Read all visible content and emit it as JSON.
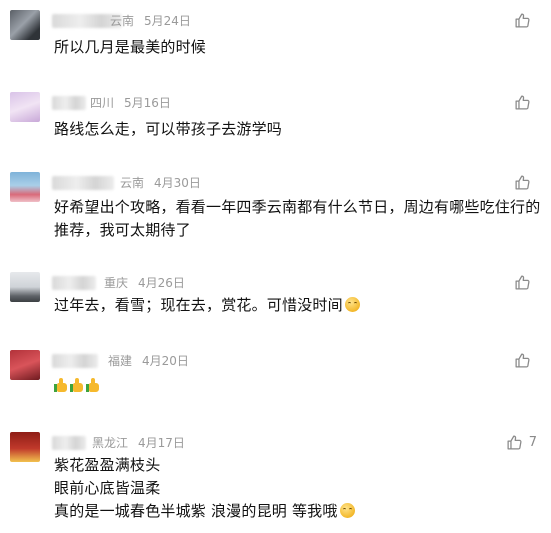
{
  "comments": [
    {
      "region": "云南",
      "date": "5月24日",
      "lines": [
        "所以几月是最美的时候"
      ],
      "like_count": ""
    },
    {
      "region": "四川",
      "date": "5月16日",
      "lines": [
        "路线怎么走，可以带孩子去游学吗"
      ],
      "like_count": ""
    },
    {
      "region": "云南",
      "date": "4月30日",
      "lines": [
        "好希望出个攻略，看看一年四季云南都有什么节日，周边有哪些吃住行的",
        "推荐，我可太期待了"
      ],
      "like_count": ""
    },
    {
      "region": "重庆",
      "date": "4月26日",
      "lines": [
        "过年去，看雪；现在去，赏花。可惜没时间"
      ],
      "emoji": "smile-emoji",
      "like_count": ""
    },
    {
      "region": "福建",
      "date": "4月20日",
      "lines": [],
      "emoji": "thumbs-up-emoji x3",
      "like_count": ""
    },
    {
      "region": "黑龙江",
      "date": "4月17日",
      "lines": [
        "紫花盈盈满枝头",
        "眼前心底皆温柔",
        "真的是一城春色半城紫 浪漫的昆明 等我哦"
      ],
      "emoji": "smile-emoji",
      "like_count": "7"
    }
  ],
  "icons": {
    "like": "thumbs-up-outline-icon"
  }
}
